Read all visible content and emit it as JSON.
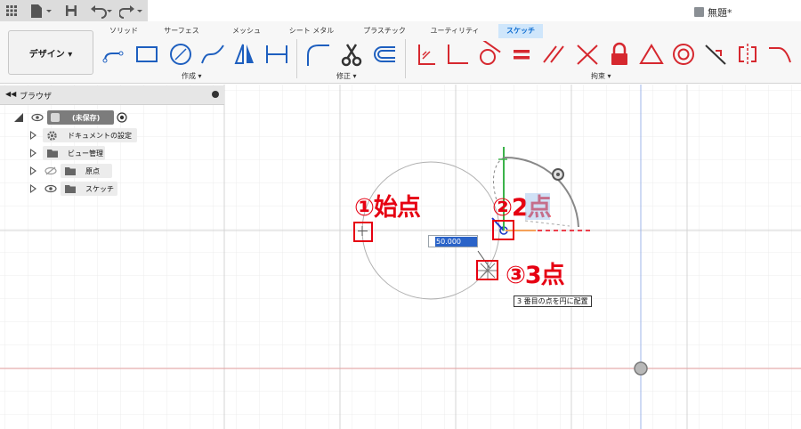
{
  "title_bar": {
    "document_title": "無題*",
    "icons": [
      "grid-menu-icon",
      "file-icon",
      "save-icon",
      "undo-icon",
      "redo-icon",
      "cube-icon"
    ]
  },
  "ribbon": {
    "workspace_button": "デザイン ▾",
    "tabs": [
      {
        "label": "ソリッド",
        "active": false
      },
      {
        "label": "サーフェス",
        "active": false
      },
      {
        "label": "メッシュ",
        "active": false
      },
      {
        "label": "シート メタル",
        "active": false
      },
      {
        "label": "プラスチック",
        "active": false
      },
      {
        "label": "ユーティリティ",
        "active": false
      },
      {
        "label": "スケッチ",
        "active": true
      }
    ],
    "groups": {
      "create": "作成 ▾",
      "modify": "修正 ▾",
      "constraints": "拘束 ▾"
    },
    "create_tools": [
      "line-icon",
      "rectangle-icon",
      "circle-icon",
      "spline-icon",
      "mirror-triangle-icon",
      "dimension-icon"
    ],
    "modify_tools": [
      "fillet-icon",
      "trim-scissors-icon",
      "offset-icon"
    ],
    "constraint_tools": [
      "fix-icon",
      "perpendicular-icon",
      "tangent-icon",
      "equal-icon",
      "parallel-icon",
      "collinear-icon",
      "lock-icon",
      "triangle-icon",
      "concentric-icon",
      "midpoint-icon",
      "symmetry-icon",
      "curvature-icon"
    ]
  },
  "browser": {
    "title": "ブラウザ",
    "root_label": "(未保存)",
    "items": [
      {
        "label": "ドキュメントの設定",
        "icon": "gear-icon"
      },
      {
        "label": "ビュー管理",
        "icon": "folder-icon"
      },
      {
        "label": "原点",
        "icon": "folder-icon"
      },
      {
        "label": "スケッチ",
        "icon": "folder-icon"
      }
    ]
  },
  "canvas": {
    "dimension_value": "50.000 mm",
    "tooltip": "3 番目の点を円に配置",
    "annotations": {
      "start": "①始点",
      "second": "②2点",
      "third": "③3点"
    }
  },
  "colors": {
    "accent_red": "#e60012",
    "tab_active": "#0b6bd0",
    "grid": "#e3e3e3",
    "axis_red": "#e8a0a0",
    "axis_blue": "#9db4e8"
  }
}
